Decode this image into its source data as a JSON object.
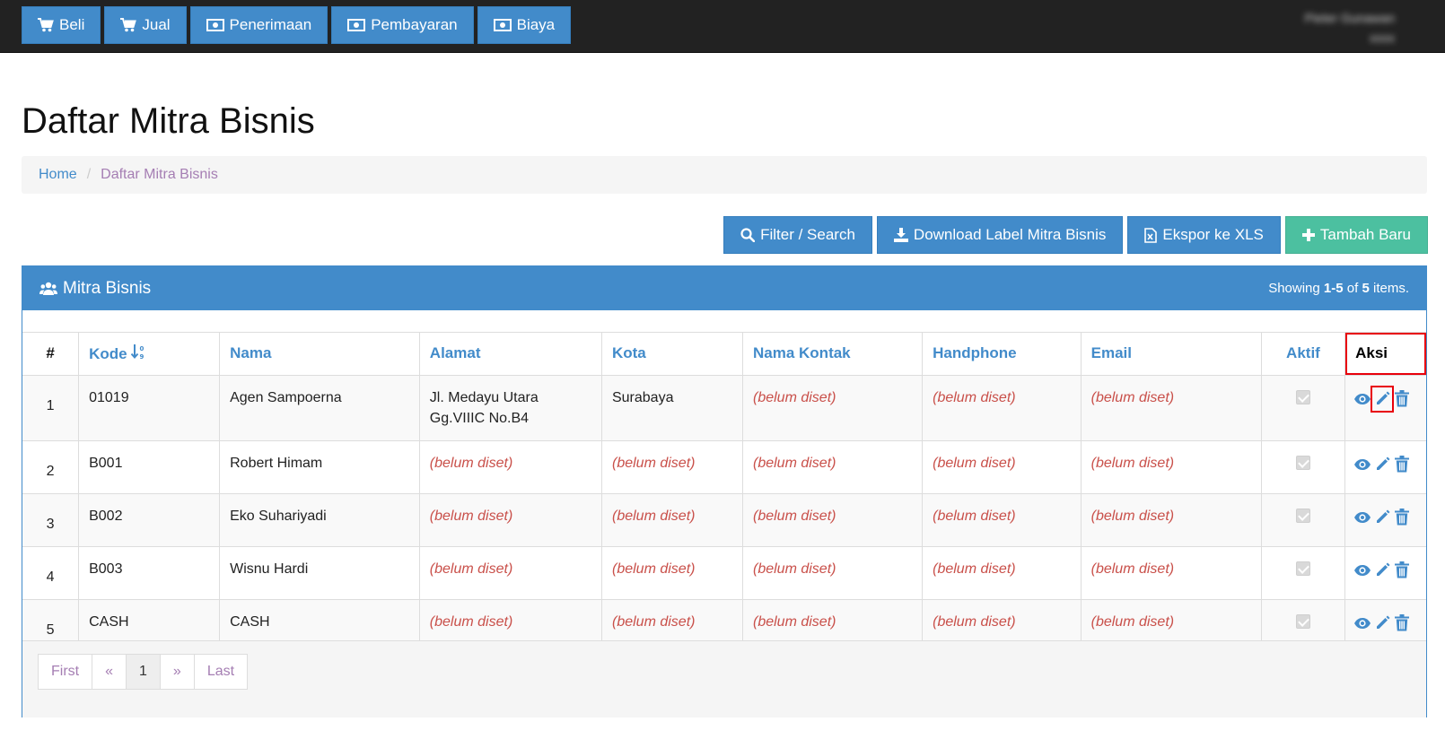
{
  "topnav": [
    {
      "label": "Beli",
      "icon": "cart-icon"
    },
    {
      "label": "Jual",
      "icon": "cart-icon"
    },
    {
      "label": "Penerimaan",
      "icon": "money-icon"
    },
    {
      "label": "Pembayaran",
      "icon": "money-icon"
    },
    {
      "label": "Biaya",
      "icon": "money-icon"
    }
  ],
  "user": {
    "line1": "Pieter Gunawan",
    "line2": "xxxx"
  },
  "page": {
    "title": "Daftar Mitra Bisnis"
  },
  "breadcrumb": {
    "home": "Home",
    "separator": "/",
    "current": "Daftar Mitra Bisnis"
  },
  "toolbar": {
    "filter": "Filter / Search",
    "download": "Download Label Mitra Bisnis",
    "export": "Ekspor ke XLS",
    "add": "Tambah Baru"
  },
  "panel": {
    "title": "Mitra Bisnis",
    "summary": {
      "prefix": "Showing ",
      "range": "1-5",
      "of": " of ",
      "total": "5",
      "suffix": " items."
    }
  },
  "table": {
    "columns": {
      "num": "#",
      "kode": "Kode",
      "nama": "Nama",
      "alamat": "Alamat",
      "kota": "Kota",
      "nama_kontak": "Nama Kontak",
      "handphone": "Handphone",
      "email": "Email",
      "aktif": "Aktif",
      "aksi": "Aksi"
    },
    "rows": [
      {
        "num": "1",
        "kode": "01019",
        "nama": "Agen Sampoerna",
        "alamat": "Jl. Medayu Utara Gg.VIIIC No.B4",
        "kota": "Surabaya",
        "nama_kontak": "(belum diset)",
        "handphone": "(belum diset)",
        "email": "(belum diset)",
        "aktif": true
      },
      {
        "num": "2",
        "kode": "B001",
        "nama": "Robert Himam",
        "alamat": "(belum diset)",
        "kota": "(belum diset)",
        "nama_kontak": "(belum diset)",
        "handphone": "(belum diset)",
        "email": "(belum diset)",
        "aktif": true
      },
      {
        "num": "3",
        "kode": "B002",
        "nama": "Eko Suhariyadi",
        "alamat": "(belum diset)",
        "kota": "(belum diset)",
        "nama_kontak": "(belum diset)",
        "handphone": "(belum diset)",
        "email": "(belum diset)",
        "aktif": true
      },
      {
        "num": "4",
        "kode": "B003",
        "nama": "Wisnu Hardi",
        "alamat": "(belum diset)",
        "kota": "(belum diset)",
        "nama_kontak": "(belum diset)",
        "handphone": "(belum diset)",
        "email": "(belum diset)",
        "aktif": true
      },
      {
        "num": "5",
        "kode": "CASH",
        "nama": "CASH",
        "alamat": "(belum diset)",
        "kota": "(belum diset)",
        "nama_kontak": "(belum diset)",
        "handphone": "(belum diset)",
        "email": "(belum diset)",
        "aktif": true
      }
    ]
  },
  "pagination": {
    "first": "First",
    "prev": "«",
    "current": "1",
    "next": "»",
    "last": "Last"
  },
  "colors": {
    "primary": "#428bca",
    "success": "#4cc0a0",
    "unset_text": "#c9504a",
    "highlight": "#e8000b",
    "topbar": "#222222"
  }
}
